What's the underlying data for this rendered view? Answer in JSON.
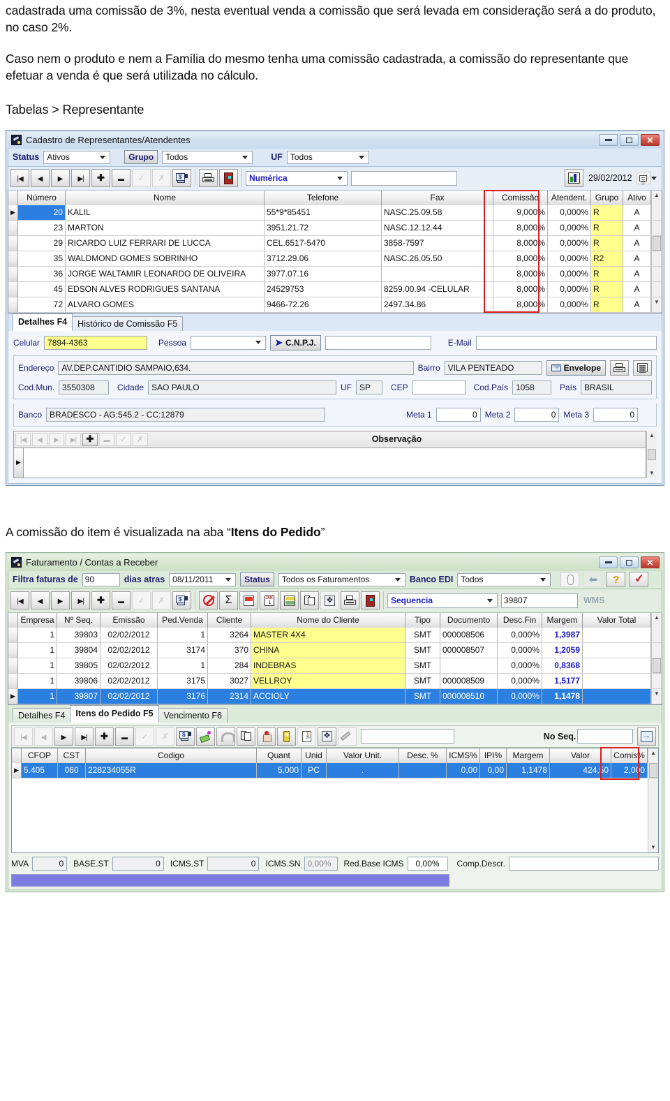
{
  "document": {
    "paragraph1": "cadastrada uma comissão de 3%, nesta eventual venda a comissão que será levada em consideração será a do produto, no caso 2%.",
    "paragraph2": "Caso nem o produto e nem a Família do mesmo tenha uma comissão cadastrada, a comissão do representante que efetuar a venda é que será utilizada no cálculo.",
    "breadcrumb": "Tabelas > Representante",
    "caption_prefix": "A comissão do item é visualizada na aba ",
    "caption_quote_open": "“",
    "caption_bold": "Itens do Pedido",
    "caption_quote_close": "”"
  },
  "colors": {
    "accent_blue": "#1b1b6e",
    "highlight_red": "#d81f1f",
    "row_selected": "#2b7fe0",
    "cell_yellow": "#ffff8d",
    "window_blue": "#d6e4f2",
    "window_green": "#dceada",
    "purple_bar": "#7b7be0"
  },
  "window1": {
    "title": "Cadastro de Representantes/Atendentes",
    "icon": "app-icon",
    "controls": {
      "minimize": "minimize-icon",
      "maximize": "maximize-icon",
      "close": "close-icon"
    },
    "filters": [
      {
        "label": "Status",
        "value": "Ativos",
        "type": "combo"
      },
      {
        "label": "Grupo",
        "value": "Todos",
        "type": "button-combo"
      },
      {
        "label": "UF",
        "value": "Todos",
        "type": "combo"
      }
    ],
    "toolbar": {
      "nav": [
        "first-record-icon",
        "previous-record-icon",
        "next-record-icon",
        "last-record-icon",
        "add-record-icon",
        "delete-record-icon",
        "edit-record-icon",
        "cancel-edit-icon",
        "grid-export-icon"
      ],
      "actions": [
        "print-icon",
        "exit-door-icon"
      ],
      "search_mode": "Numérica",
      "search_value": "",
      "chart_icon": "chart-icon",
      "date": "29/02/2012",
      "date_picker": "calendar-picker-icon"
    },
    "grid": {
      "columns": [
        "Número",
        "Nome",
        "Telefone",
        "Fax",
        "Comissão",
        "Atendent.",
        "Grupo",
        "Ativo"
      ],
      "rows": [
        {
          "numero": "20",
          "nome": "KALIL",
          "telefone": "55*9*85451",
          "fax": "NASC.25.09.58",
          "comissao": "9,000%",
          "atendent": "0,000%",
          "grupo": "R",
          "ativo": "A",
          "selected": true
        },
        {
          "numero": "23",
          "nome": "MARTON",
          "telefone": "3951.21.72",
          "fax": "NASC.12.12.44",
          "comissao": "8,000%",
          "atendent": "0,000%",
          "grupo": "R",
          "ativo": "A",
          "selected": false
        },
        {
          "numero": "29",
          "nome": "RICARDO  LUIZ FERRARI DE LUCCA",
          "telefone": "CEL.6517-5470",
          "fax": "3858-7597",
          "comissao": "8,000%",
          "atendent": "0,000%",
          "grupo": "R",
          "ativo": "A",
          "selected": false
        },
        {
          "numero": "35",
          "nome": "WALDMOND GOMES SOBRINHO",
          "telefone": "3712.29.06",
          "fax": "NASC.26.05.50",
          "comissao": "8,000%",
          "atendent": "0,000%",
          "grupo": "R2",
          "ativo": "A",
          "selected": false
        },
        {
          "numero": "36",
          "nome": "JORGE  WALTAMIR LEONARDO DE OLIVEIRA",
          "telefone": "3977.07.16",
          "fax": "",
          "comissao": "8,000%",
          "atendent": "0,000%",
          "grupo": "R",
          "ativo": "A",
          "selected": false
        },
        {
          "numero": "45",
          "nome": "EDSON ALVES RODRIGUES SANTANA",
          "telefone": "24529753",
          "fax": "8259.00.94 -CELULAR",
          "comissao": "8,000%",
          "atendent": "0,000%",
          "grupo": "R",
          "ativo": "A",
          "selected": false
        },
        {
          "numero": "72",
          "nome": "ALVARO GOMES",
          "telefone": "9466-72.26",
          "fax": "2497.34.86",
          "comissao": "8,000%",
          "atendent": "0,000%",
          "grupo": "R",
          "ativo": "A",
          "selected": false
        }
      ],
      "highlighted_column": "Comissão"
    },
    "tabs": [
      {
        "label": "Detalhes  F4",
        "active": true
      },
      {
        "label": "Histórico de Comissão  F5",
        "active": false
      }
    ],
    "form": {
      "celular_label": "Celular",
      "celular_value": "7894-4363",
      "pessoa_label": "Pessoa",
      "pessoa_value": "",
      "cnpj_button": "C.N.P.J.",
      "cnpj_value": "",
      "email_label": "E-Mail",
      "email_value": "",
      "endereco_label": "Endereço",
      "endereco_value": "AV.DEP.CANTIDIO SAMPAIO,634.",
      "bairro_label": "Bairro",
      "bairro_value": "VILA PENTEADO",
      "envelope_button": "Envelope",
      "print_icon": "print-icon",
      "lines_icon": "list-lines-icon",
      "codmun_label": "Cod.Mun.",
      "codmun_value": "3550308",
      "cidade_label": "Cidade",
      "cidade_value": "SAO PAULO",
      "uf_label": "UF",
      "uf_value": "SP",
      "cep_label": "CEP",
      "cep_value": "",
      "codpais_label": "Cod.País",
      "codpais_value": "1058",
      "pais_label": "País",
      "pais_value": "BRASIL",
      "banco_label": "Banco",
      "banco_value": "BRADESCO - AG:545.2 - CC:12879",
      "meta1_label": "Meta 1",
      "meta1_value": "0",
      "meta2_label": "Meta 2",
      "meta2_value": "0",
      "meta3_label": "Meta 3",
      "meta3_value": "0",
      "observacao_title": "Observação",
      "observacao_value": ""
    }
  },
  "window2": {
    "title": "Faturamento / Contas a Receber",
    "icon": "app-icon",
    "controls": {
      "minimize": "minimize-icon",
      "maximize": "maximize-icon",
      "close": "close-icon"
    },
    "filterbar": {
      "filtra_label": "Filtra faturas de",
      "days_value": "90",
      "dias_atras_label": "dias atras",
      "date_value": "08/11/2011",
      "status_button": "Status",
      "status_value": "Todos os Faturamentos",
      "banco_edi_label": "Banco EDI",
      "banco_edi_value": "Todos",
      "icons": [
        "paperclip-icon",
        "back-arrow-icon",
        "help-question-icon",
        "confirm-check-icon"
      ]
    },
    "toolbar": {
      "nav": [
        "first-record-icon",
        "previous-record-icon",
        "next-record-icon",
        "last-record-icon",
        "add-record-icon",
        "delete-record-icon",
        "edit-record-icon",
        "cancel-edit-icon",
        "grid-export-icon"
      ],
      "actions": [
        "cancel-invoice-icon",
        "sum-sigma-icon",
        "note-icon",
        "calendar-icon",
        "money-icon",
        "duplicate-icon",
        "disabled-icon",
        "print-icon",
        "exit-door-icon"
      ],
      "search_mode": "Sequencia",
      "search_value": "39807",
      "wms_label": "WMS"
    },
    "grid": {
      "columns": [
        "Empresa",
        "Nº Seq.",
        "Emissão",
        "Ped.Venda",
        "Cliente",
        "Nome do Cliente",
        "Tipo",
        "Documento",
        "Desc.Fin",
        "Margem",
        "Valor Total"
      ],
      "rows": [
        {
          "empresa": "1",
          "seq": "39803",
          "emissao": "02/02/2012",
          "pedvenda": "1",
          "cliente": "3264",
          "nome": "MASTER 4X4",
          "tipo": "SMT",
          "documento": "000008506",
          "descfin": "0,000%",
          "margem": "1,3987",
          "valortotal": "",
          "selected": false
        },
        {
          "empresa": "1",
          "seq": "39804",
          "emissao": "02/02/2012",
          "pedvenda": "3174",
          "cliente": "370",
          "nome": "CHINA",
          "tipo": "SMT",
          "documento": "000008507",
          "descfin": "0,000%",
          "margem": "1,2059",
          "valortotal": "",
          "selected": false
        },
        {
          "empresa": "1",
          "seq": "39805",
          "emissao": "02/02/2012",
          "pedvenda": "1",
          "cliente": "284",
          "nome": "INDEBRAS",
          "tipo": "SMT",
          "documento": "",
          "descfin": "0,000%",
          "margem": "0,8368",
          "valortotal": "",
          "selected": false
        },
        {
          "empresa": "1",
          "seq": "39806",
          "emissao": "02/02/2012",
          "pedvenda": "3175",
          "cliente": "3027",
          "nome": "VELLROY",
          "tipo": "SMT",
          "documento": "000008509",
          "descfin": "0,000%",
          "margem": "1,5177",
          "valortotal": "",
          "selected": false
        },
        {
          "empresa": "1",
          "seq": "39807",
          "emissao": "02/02/2012",
          "pedvenda": "3176",
          "cliente": "2314",
          "nome": "ACCIOLY",
          "tipo": "SMT",
          "documento": "000008510",
          "descfin": "0,000%",
          "margem": "1,1478",
          "valortotal": "",
          "selected": true
        }
      ]
    },
    "tabs": [
      {
        "label": "Detalhes  F4",
        "active": false
      },
      {
        "label": "Itens do Pedido  F5",
        "active": true
      },
      {
        "label": "Vencimento F6",
        "active": false
      }
    ],
    "items_toolbar": {
      "nav": [
        "first-record-icon",
        "previous-record-icon",
        "next-record-icon",
        "last-record-icon",
        "add-record-icon",
        "delete-record-icon",
        "edit-record-icon",
        "cancel-edit-icon",
        "grid-export-icon"
      ],
      "actions": [
        "eraser-icon",
        "magnet-icon",
        "duplicate-icon",
        "santa-icon",
        "traffic-light-icon",
        "person-icon",
        "move-icon",
        "pencil-icon"
      ],
      "search_value": "",
      "no_seq_label": "No Seq.",
      "no_seq_value": "",
      "exit_icon": "exit-door-icon"
    },
    "items_grid": {
      "columns": [
        "CFOP",
        "CST",
        "Codigo",
        "Quant",
        "Unid",
        "Valor Unit.",
        "Desc. %",
        "ICMS%",
        "IPI%",
        "Margem",
        "Valor",
        "Comis%"
      ],
      "rows": [
        {
          "cfop": "5.405",
          "cst": "060",
          "codigo": "228234055R",
          "quant": "5,000",
          "unid": "PC",
          "valorunit": ".",
          "desc": "",
          "icms": "0,00",
          "ipi": "0,00",
          "margem": "1,1478",
          "valor": "424,50",
          "comis": "2,000",
          "selected": true
        }
      ],
      "highlighted_column": "Comis%"
    },
    "footer": {
      "mva_label": "MVA",
      "mva_value": "0",
      "basest_label": "BASE.ST",
      "basest_value": "0",
      "icmsst_label": "ICMS.ST",
      "icmsst_value": "0",
      "icmssn_label": "ICMS.SN",
      "icmssn_value": "0,00%",
      "redbase_label": "Red.Base ICMS",
      "redbase_value": "0,00%",
      "compdescr_label": "Comp.Descr.",
      "compdescr_value": ""
    }
  }
}
